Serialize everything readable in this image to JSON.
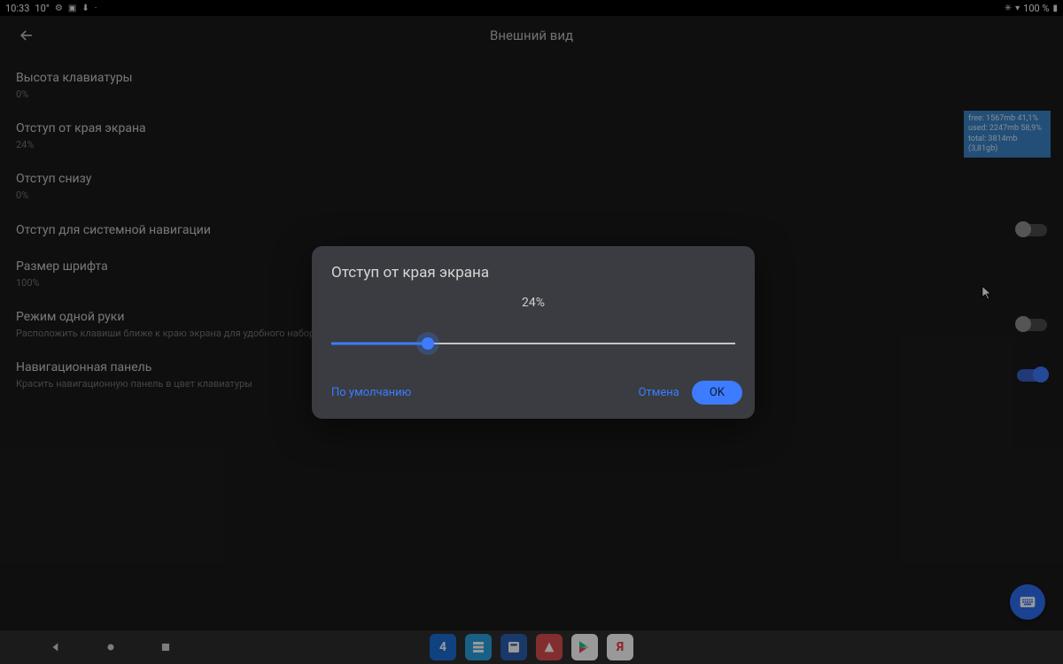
{
  "statusbar": {
    "time": "10:33",
    "temp": "10°",
    "battery_text": "100 %"
  },
  "header": {
    "title": "Внешний вид"
  },
  "settings": [
    {
      "label": "Высота клавиатуры",
      "sub": "0%",
      "toggle": null
    },
    {
      "label": "Отступ от края экрана",
      "sub": "24%",
      "toggle": null
    },
    {
      "label": "Отступ снизу",
      "sub": "0%",
      "toggle": null
    },
    {
      "label": "Отступ для системной навигации",
      "sub": "",
      "toggle": false
    },
    {
      "label": "Размер шрифта",
      "sub": "100%",
      "toggle": null
    },
    {
      "label": "Режим одной руки",
      "sub": "Расположить клавиши ближе к краю экрана для удобного набора одн",
      "toggle": false
    },
    {
      "label": "Навигационная панель",
      "sub": "Красить навигационную панель в цвет клавиатуры",
      "toggle": true
    }
  ],
  "meminfo": {
    "line1": "free: 1567mb 41,1%",
    "line2": "used: 2247mb 58,9%",
    "line3": "total: 3814mb (3,81gb)"
  },
  "dialog": {
    "title": "Отступ от края экрана",
    "value_text": "24%",
    "slider_percent": 24,
    "default_label": "По умолчанию",
    "cancel_label": "Отмена",
    "ok_label": "OK"
  }
}
